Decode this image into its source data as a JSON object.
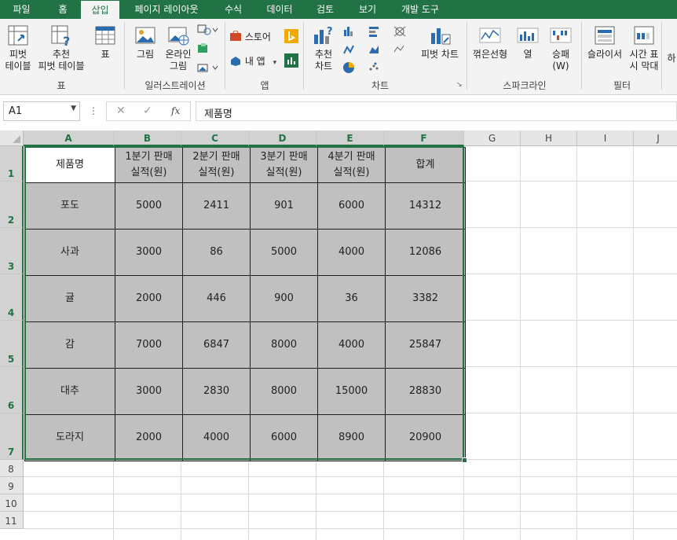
{
  "tabs": [
    {
      "label": "파일"
    },
    {
      "label": "홈"
    },
    {
      "label": "삽입"
    },
    {
      "label": "페이지 레이아웃"
    },
    {
      "label": "수식"
    },
    {
      "label": "데이터"
    },
    {
      "label": "검토"
    },
    {
      "label": "보기"
    },
    {
      "label": "개발 도구"
    }
  ],
  "ribbon": {
    "pivot_table": "피벗\n테이블",
    "recommended_pivot": "추천\n피벗 테이블",
    "table": "표",
    "group_tables": "표",
    "pictures": "그림",
    "online_pictures": "온라인\n그림",
    "group_illustrations": "일러스트레이션",
    "store": "스토어",
    "my_addins": "내 앱",
    "group_addins": "앱",
    "recommended_charts": "추천\n차트",
    "pivot_chart": "피벗 차트",
    "group_charts": "차트",
    "spark_line": "꺾은선형",
    "spark_column": "열",
    "spark_winloss": "승패\n(W)",
    "group_sparklines": "스파크라인",
    "slicer": "슬라이서",
    "timeline": "시간 표\n시 막대",
    "group_filters": "필터",
    "hyperlink_partial": "하"
  },
  "formula_bar": {
    "name_box": "A1",
    "formula": "제품명"
  },
  "columns": [
    "A",
    "B",
    "C",
    "D",
    "E",
    "F",
    "G",
    "H",
    "I",
    "J"
  ],
  "rows": [
    "1",
    "2",
    "3",
    "4",
    "5",
    "6",
    "7",
    "8",
    "9",
    "10",
    "11"
  ],
  "table": {
    "headers": [
      "제품명",
      "1분기 판매\n실적(원)",
      "2분기 판매\n실적(원)",
      "3분기 판매\n실적(원)",
      "4분기 판매\n실적(원)",
      "합계"
    ],
    "rows": [
      [
        "포도",
        "5000",
        "2411",
        "901",
        "6000",
        "14312"
      ],
      [
        "사과",
        "3000",
        "86",
        "5000",
        "4000",
        "12086"
      ],
      [
        "귤",
        "2000",
        "446",
        "900",
        "36",
        "3382"
      ],
      [
        "감",
        "7000",
        "6847",
        "8000",
        "4000",
        "25847"
      ],
      [
        "대추",
        "3000",
        "2830",
        "8000",
        "15000",
        "28830"
      ],
      [
        "도라지",
        "2000",
        "4000",
        "6000",
        "8900",
        "20900"
      ]
    ]
  },
  "colors": {
    "accent": "#217346",
    "cell_fill": "#c0c0c0"
  }
}
